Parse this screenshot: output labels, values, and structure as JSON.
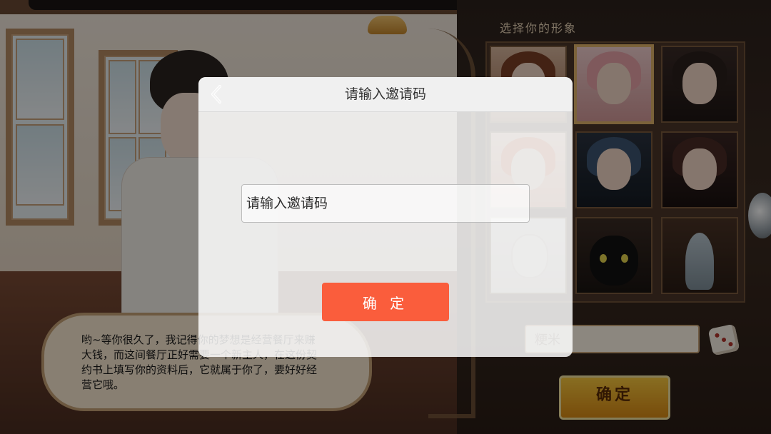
{
  "select_avatar": {
    "title": "选择你的形象",
    "avatars": [
      {
        "name": "brown-hair-girl-avatar"
      },
      {
        "name": "pink-hair-girl-avatar",
        "selected": true
      },
      {
        "name": "dark-hair-girl-avatar"
      },
      {
        "name": "orange-hair-boy-avatar"
      },
      {
        "name": "blue-hair-man-avatar"
      },
      {
        "name": "dark-hair-woman-avatar"
      },
      {
        "name": "chef-avatar"
      },
      {
        "name": "black-cat-avatar"
      },
      {
        "name": "fish-avatar"
      }
    ]
  },
  "name_field": {
    "value": "粳米"
  },
  "confirm_gold_label": "确定",
  "dialogue": {
    "text": "哟~等你很久了，我记得你的梦想是经营餐厅来赚大钱，而这间餐厅正好需要一个新主人，在这份契约书上填写你的资料后，它就属于你了，要好好经营它哦。"
  },
  "modal": {
    "title": "请输入邀请码",
    "input_placeholder": "请输入邀请码",
    "confirm_label": "确 定"
  },
  "colors": {
    "accent": "#fa5d3c",
    "gold": "#f8c83e"
  }
}
